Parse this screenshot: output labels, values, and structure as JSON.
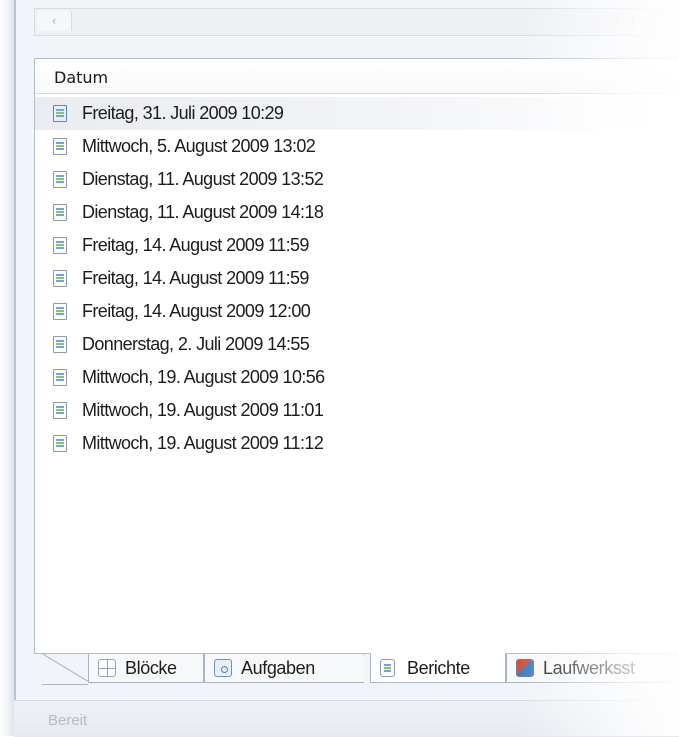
{
  "list": {
    "column_header": "Datum",
    "items": [
      {
        "label": "Freitag, 31. Juli 2009 10:29",
        "icon": "report-document-icon",
        "selected": true
      },
      {
        "label": "Mittwoch, 5. August 2009 13:02",
        "icon": "report-document-icon"
      },
      {
        "label": "Dienstag, 11. August 2009 13:52",
        "icon": "report-document-icon"
      },
      {
        "label": "Dienstag, 11. August 2009 14:18",
        "icon": "report-document-icon"
      },
      {
        "label": "Freitag, 14. August 2009 11:59",
        "icon": "report-document-icon"
      },
      {
        "label": "Freitag, 14. August 2009 11:59",
        "icon": "report-document-icon"
      },
      {
        "label": "Freitag, 14. August 2009 12:00",
        "icon": "report-document-icon"
      },
      {
        "label": "Donnerstag, 2. Juli 2009 14:55",
        "icon": "report-document-icon"
      },
      {
        "label": "Mittwoch, 19. August 2009 10:56",
        "icon": "report-document-icon"
      },
      {
        "label": "Mittwoch, 19. August 2009 11:01",
        "icon": "report-document-icon"
      },
      {
        "label": "Mittwoch, 19. August 2009 11:12",
        "icon": "report-document-icon"
      }
    ]
  },
  "tabs": [
    {
      "label": "Blöcke",
      "icon": "blocks-icon"
    },
    {
      "label": "Aufgaben",
      "icon": "tasks-icon"
    },
    {
      "label": "Berichte",
      "icon": "reports-icon",
      "active": true
    },
    {
      "label": "Laufwerksst",
      "icon": "drives-icon"
    }
  ],
  "scrollbar": {
    "left_arrow": "‹"
  },
  "status": {
    "text": "Bereit"
  }
}
